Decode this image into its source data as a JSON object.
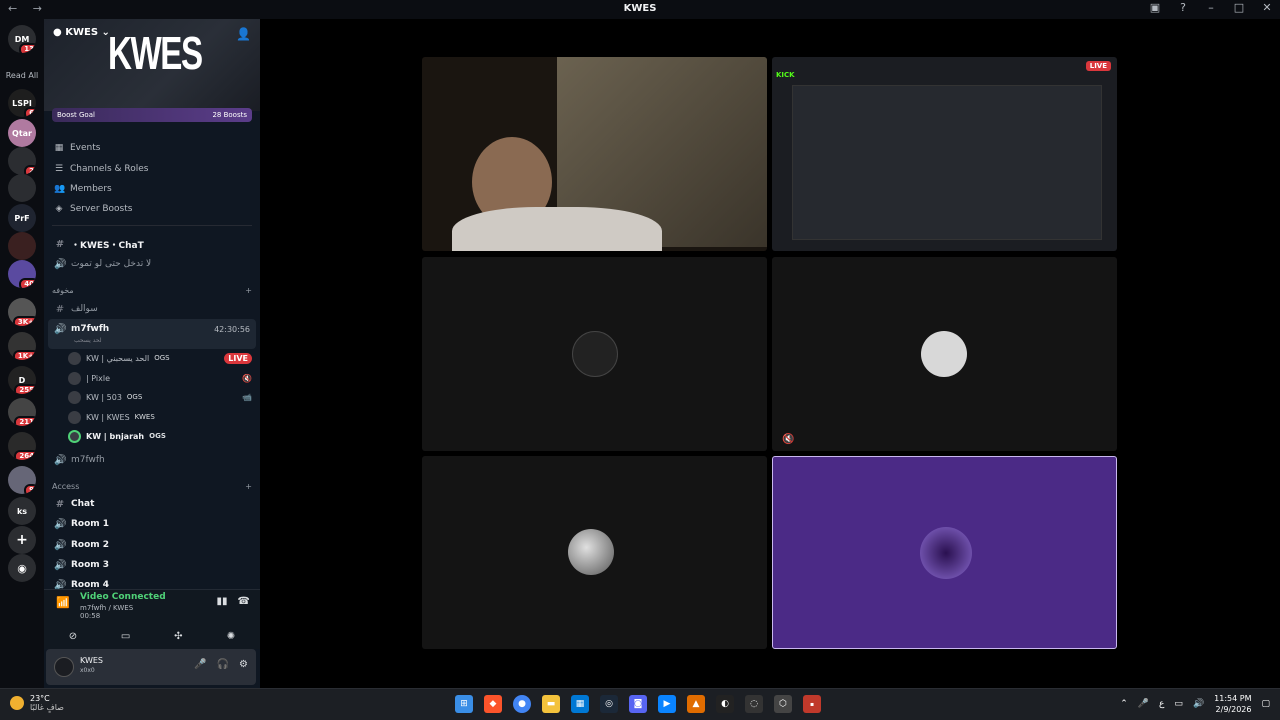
{
  "window": {
    "title": "KWES",
    "nav": "← →"
  },
  "servers": {
    "read_all": "Read All",
    "items": [
      {
        "label": "DM",
        "badge": "13",
        "color": "#3b5bdb"
      },
      {
        "label": "LSPI",
        "badge": "6",
        "color": "#1e1e1e"
      },
      {
        "label": "Qtar",
        "badge": "",
        "color": "#b07aa0"
      },
      {
        "label": "",
        "badge": "2",
        "color": "#2b2d31"
      },
      {
        "label": "",
        "badge": "",
        "color": "#2b2d31"
      },
      {
        "label": "PrF",
        "badge": "",
        "color": "#1f2430"
      },
      {
        "label": "",
        "badge": "",
        "color": "#3a2020"
      },
      {
        "label": "",
        "badge": "40",
        "color": "#5a4aa0"
      },
      {
        "label": "",
        "badge": "3K+",
        "color": "#555"
      },
      {
        "label": "",
        "badge": "1K+",
        "color": "#333"
      },
      {
        "label": "D",
        "badge": "255",
        "color": "#222"
      },
      {
        "label": "",
        "badge": "211",
        "color": "#444"
      },
      {
        "label": "",
        "badge": "264",
        "color": "#2a2a2a"
      },
      {
        "label": "",
        "badge": "9",
        "color": "#667"
      },
      {
        "label": "ks",
        "badge": "",
        "color": "#2b2d31"
      }
    ]
  },
  "server": {
    "name": "KWES",
    "banner_logo": "KWES",
    "boost_goal": "Boost Goal",
    "boost_count": "28 Boosts",
    "menu": [
      "Events",
      "Channels & Roles",
      "Members",
      "Server Boosts"
    ]
  },
  "channels": {
    "chat_channel": "・KWES・ChaT",
    "voice_arabic": "لا تدخل حتى لو تموت",
    "category1": "مخوفه",
    "text_arabic": "سوالف",
    "active_voice": "m7fwfh",
    "active_timer": "42:30:56",
    "active_sub": "لحد يسحب",
    "members": [
      {
        "name": "KW | الحد يسحبني",
        "tag": "OGS",
        "right": "LIVE"
      },
      {
        "name": "| Pixle",
        "tag": "",
        "right": "🔇"
      },
      {
        "name": "KW | 503",
        "tag": "OGS",
        "right": "📹"
      },
      {
        "name": "KW | KWES",
        "tag": "KWES",
        "right": ""
      },
      {
        "name": "KW | bnjarah",
        "tag": "OGS",
        "right": ""
      }
    ],
    "voice2": "m7fwfh",
    "category2": "Access",
    "access": [
      "Chat",
      "Room 1",
      "Room 2",
      "Room 3",
      "Room 4"
    ]
  },
  "voice": {
    "status": "Video Connected",
    "location": "m7fwfh / KWES",
    "duration": "00:58"
  },
  "user": {
    "name": "KWES",
    "status": "x0x0"
  },
  "stage": {
    "live": "LIVE",
    "kick": "KICK"
  },
  "taskbar": {
    "temp": "23°C",
    "weather": "صافٍ غالبًا",
    "time": "11:54 PM",
    "date": "2/9/2026",
    "lang": "ع"
  },
  "colors": {
    "accent": "#5865f2",
    "live": "#da373c",
    "connected": "#4fd177",
    "purple_tile": "#4b2a86"
  }
}
